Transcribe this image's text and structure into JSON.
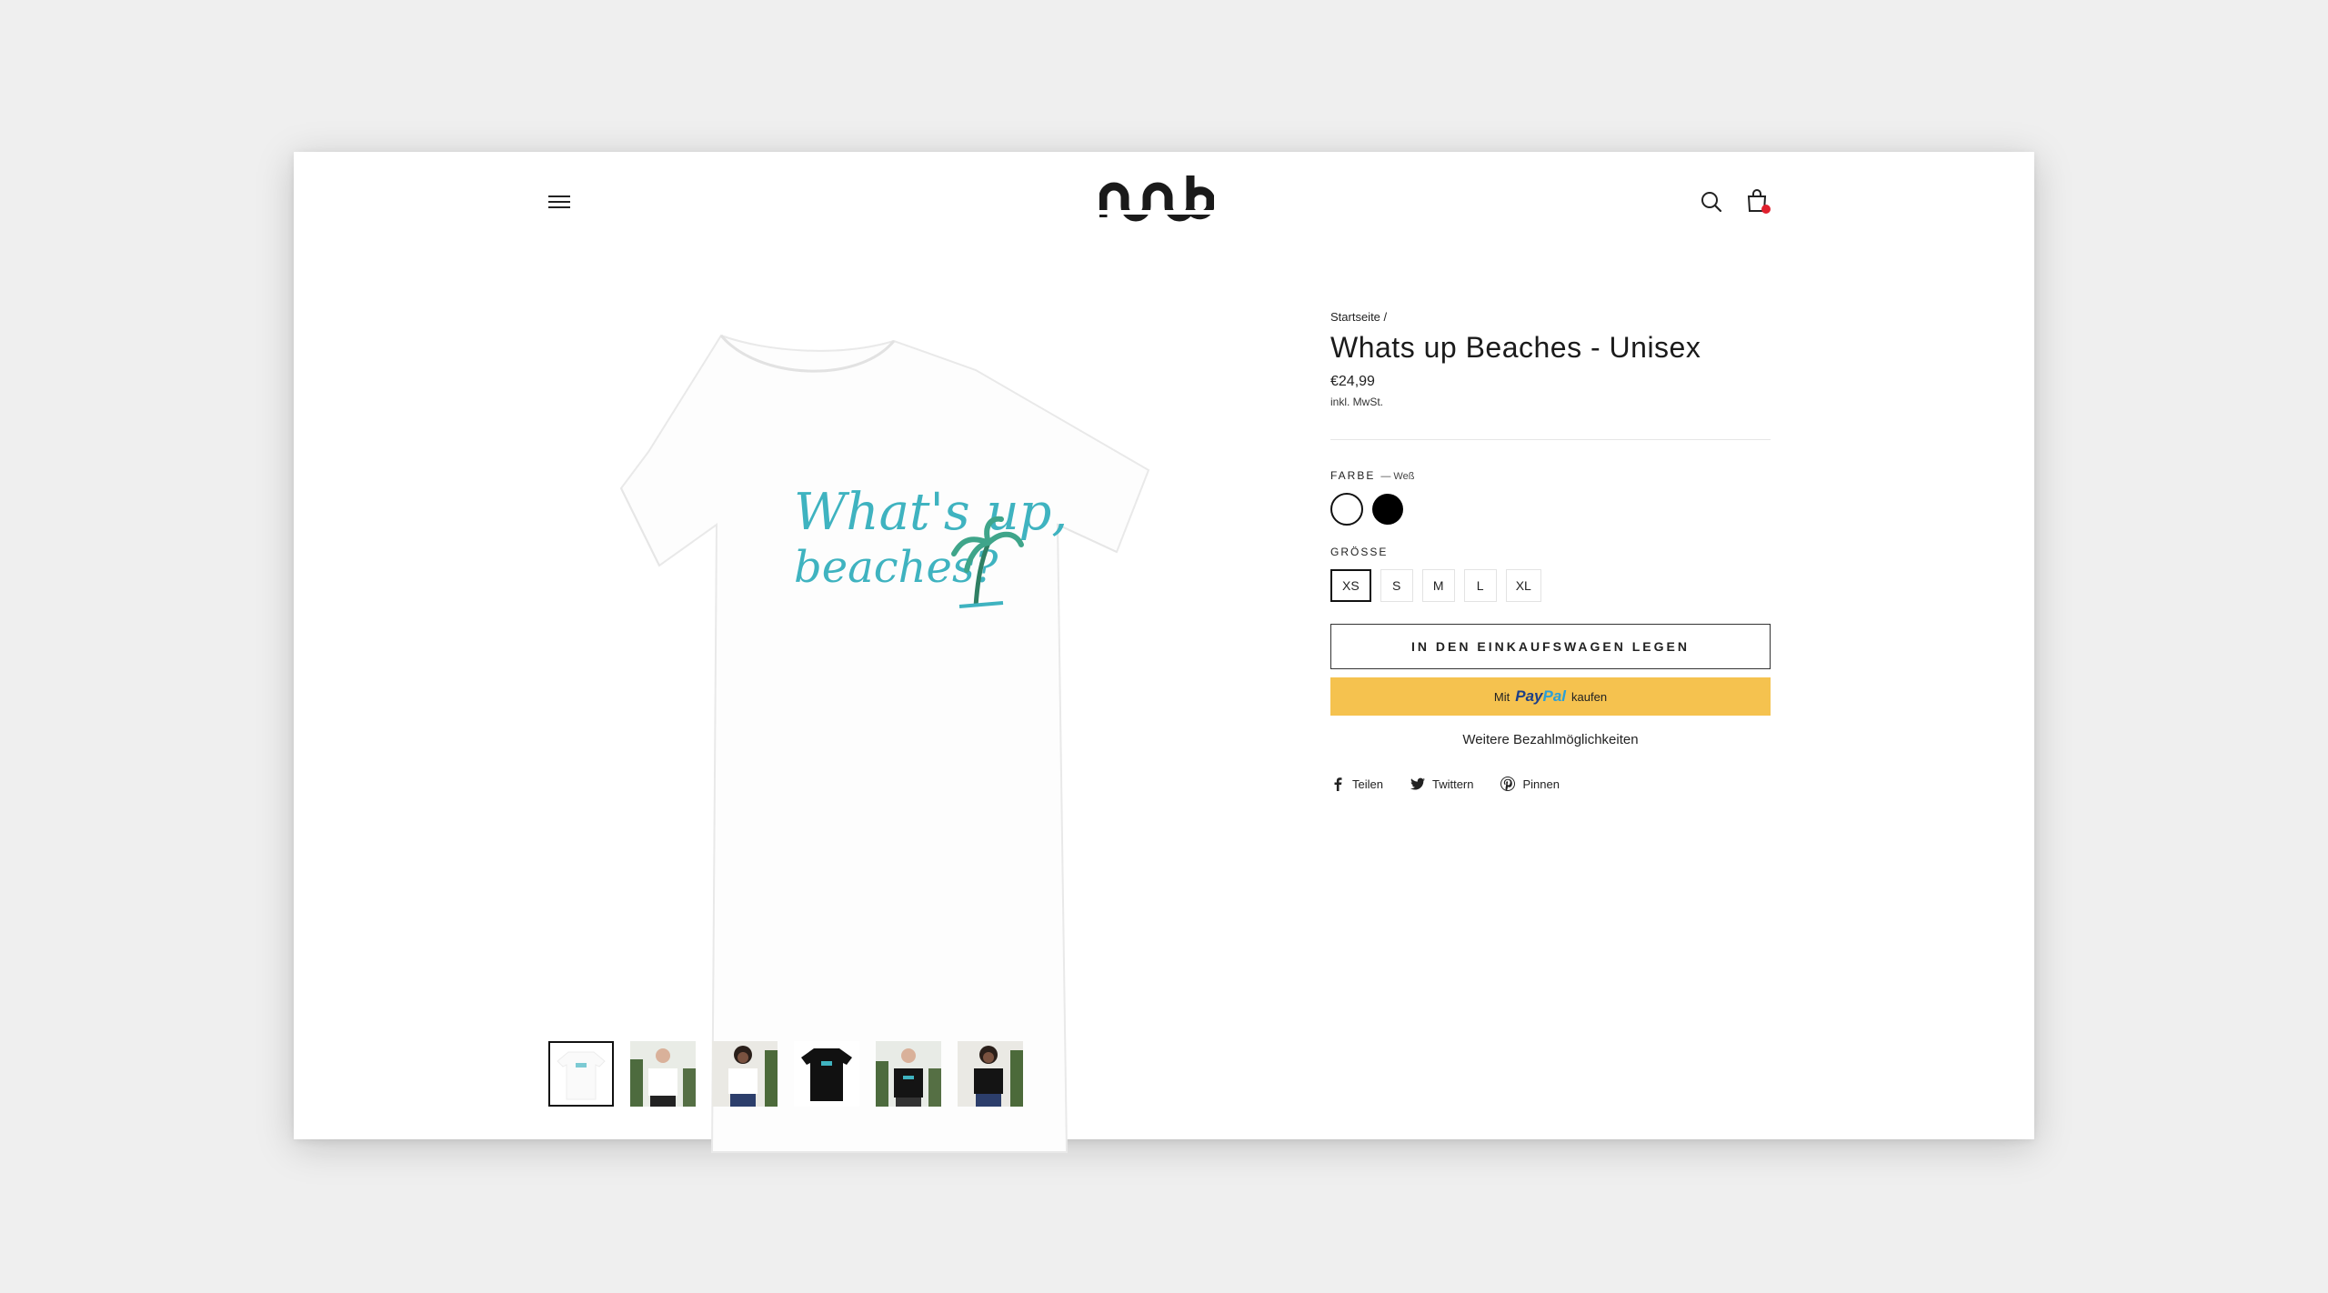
{
  "header": {
    "menu_icon": "hamburger-icon",
    "logo_icon": "brand-logo",
    "search_icon": "search-icon",
    "cart_icon": "shopping-bag-icon"
  },
  "product": {
    "breadcrumb": "Startseite /",
    "title": "Whats up Beaches - Unisex",
    "price": "€24,99",
    "tax_note": "inkl. MwSt.",
    "color_label": "FARBE",
    "color_selected": "— Weß",
    "colors": [
      "#ffffff",
      "#000000"
    ],
    "size_label": "GRÖSSE",
    "sizes": [
      "XS",
      "S",
      "M",
      "L",
      "XL"
    ],
    "size_selected": "XS",
    "add_to_cart": "IN DEN EINKAUFSWAGEN LEGEN",
    "paypal_prefix": "Mit",
    "paypal_brand_1": "Pay",
    "paypal_brand_2": "Pal",
    "paypal_suffix": "kaufen",
    "more_payment": "Weitere Bezahlmöglichkeiten",
    "shirt_print_line1": "What's up,",
    "shirt_print_line2": "beaches?"
  },
  "share": {
    "facebook": "Teilen",
    "twitter": "Twittern",
    "pinterest": "Pinnen"
  },
  "colors": {
    "paypal_button": "#f5c24f",
    "cart_badge": "#e0202e",
    "print_teal": "#3fb3c0"
  }
}
